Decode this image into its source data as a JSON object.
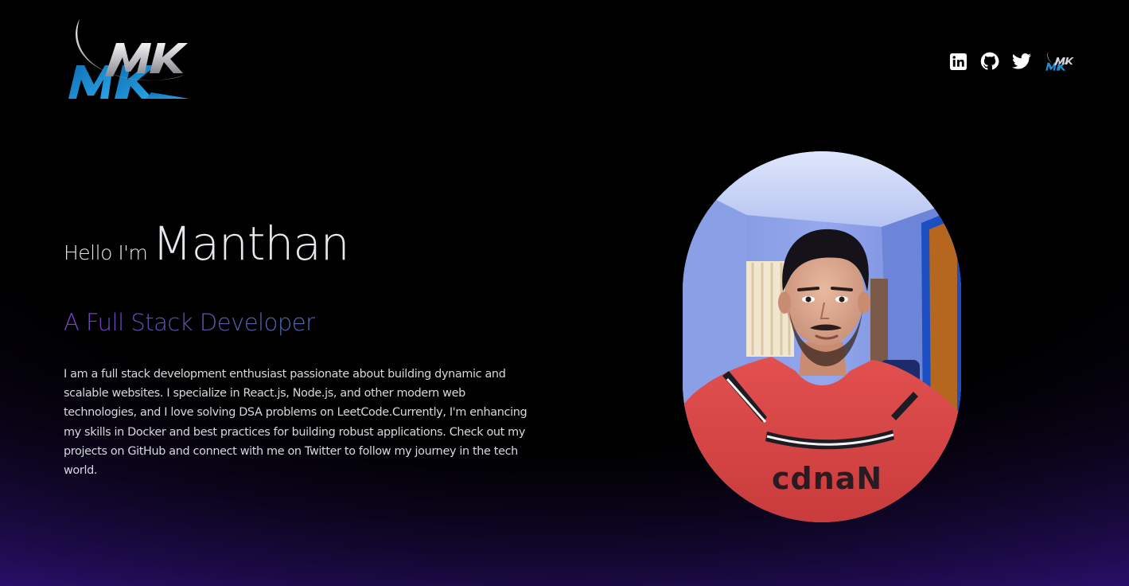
{
  "header": {
    "logo_alt": "MK",
    "social": [
      {
        "name": "LinkedIn",
        "icon": "linkedin-icon"
      },
      {
        "name": "GitHub",
        "icon": "github-icon"
      },
      {
        "name": "Twitter",
        "icon": "twitter-icon"
      },
      {
        "name": "MK",
        "icon": "mk-logo-icon"
      }
    ]
  },
  "hero": {
    "greeting": "Hello I'm",
    "name": "Manthan",
    "role": "A Full Stack Developer",
    "bio": "I am a full stack development enthusiast passionate about building dynamic and scalable websites. I specialize in React.js, Node.js, and other modern web technologies, and I love solving DSA problems on LeetCode.Currently, I'm enhancing my skills in Docker and best practices for building robust applications. Check out my projects on GitHub and connect with me on Twitter to follow my journey in the tech world."
  },
  "profile_photo": {
    "shirt_text": "cdnaN"
  },
  "colors": {
    "background": "#000000",
    "bottom_glow": "#2a0f6b",
    "role_gradient_start": "#7a3ec9",
    "role_gradient_end": "#4f6fbd",
    "logo_blue": "#1e8fd6",
    "logo_silver": "#c9c9cf"
  }
}
